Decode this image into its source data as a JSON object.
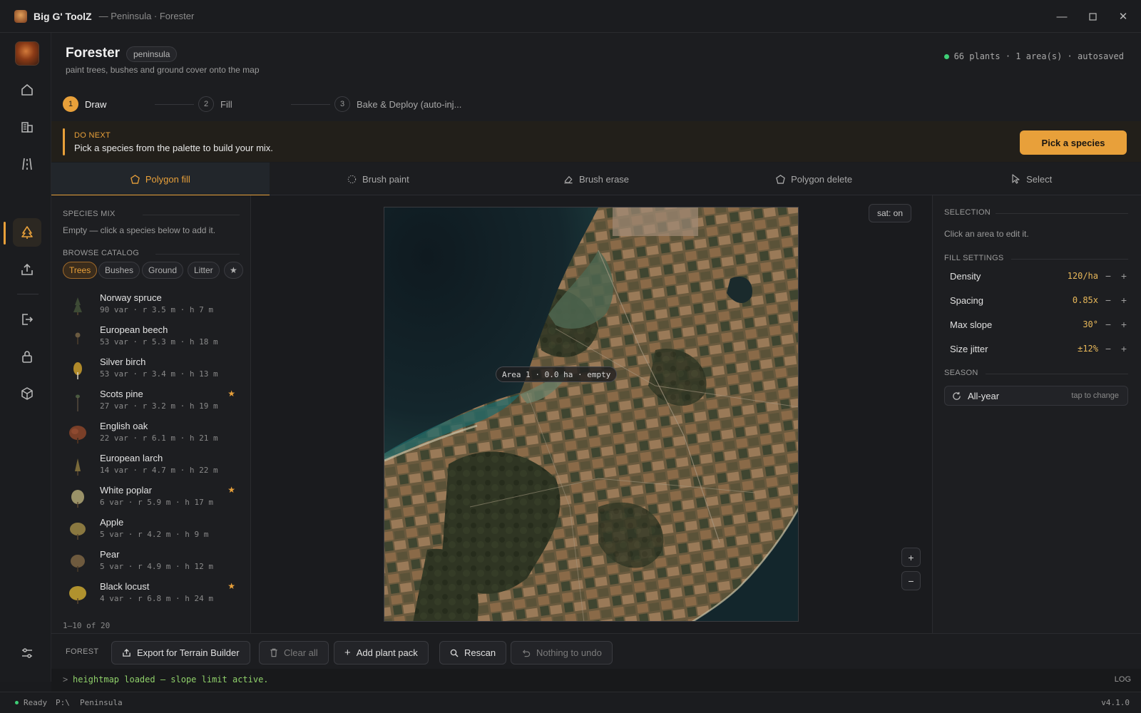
{
  "window": {
    "app_name": "Big G' ToolZ",
    "subtitle": "— Peninsula · Forester"
  },
  "rail": {
    "items": [
      {
        "name": "home",
        "icon": "home-icon"
      },
      {
        "name": "buildings",
        "icon": "buildings-icon"
      },
      {
        "name": "roads",
        "icon": "road-icon"
      },
      {
        "name": "forester",
        "icon": "tree-icon",
        "active": true
      },
      {
        "name": "export",
        "icon": "upload-tray-icon"
      },
      {
        "name": "deploy",
        "icon": "arrow-out-icon"
      },
      {
        "name": "lock",
        "icon": "lock-icon"
      },
      {
        "name": "assets",
        "icon": "cube-icon"
      },
      {
        "name": "settings",
        "icon": "sliders-icon"
      }
    ]
  },
  "header": {
    "title": "Forester",
    "badge": "peninsula",
    "subtitle": "paint trees, bushes and ground cover onto the map",
    "status": "66 plants · 1 area(s) · autosaved"
  },
  "stepper": {
    "steps": [
      {
        "num": "1",
        "label": "Draw"
      },
      {
        "num": "2",
        "label": "Fill"
      },
      {
        "num": "3",
        "label": "Bake & Deploy (auto-inj..."
      }
    ]
  },
  "banner": {
    "kicker": "DO NEXT",
    "text": "Pick a species from the palette to build your mix.",
    "button": "Pick a species"
  },
  "tools": {
    "tabs": [
      {
        "label": "Polygon fill",
        "icon": "polygon-icon"
      },
      {
        "label": "Brush paint",
        "icon": "brush-dots-icon"
      },
      {
        "label": "Brush erase",
        "icon": "eraser-icon"
      },
      {
        "label": "Polygon delete",
        "icon": "polygon-icon"
      },
      {
        "label": "Select",
        "icon": "cursor-icon"
      }
    ]
  },
  "species": {
    "mix_label": "SPECIES MIX",
    "mix_empty": "Empty — click a species below to add it.",
    "catalog_label": "BROWSE CATALOG",
    "filters": [
      "Trees",
      "Bushes",
      "Ground",
      "Litter",
      "★"
    ],
    "items": [
      {
        "name": "Norway spruce",
        "meta": "90 var · r 3.5 m · h 7 m",
        "star": ""
      },
      {
        "name": "European beech",
        "meta": "53 var · r 5.3 m · h 18 m",
        "star": ""
      },
      {
        "name": "Silver birch",
        "meta": "53 var · r 3.4 m · h 13 m",
        "star": ""
      },
      {
        "name": "Scots pine",
        "meta": "27 var · r 3.2 m · h 19 m",
        "star": "★"
      },
      {
        "name": "English oak",
        "meta": "22 var · r 6.1 m · h 21 m",
        "star": ""
      },
      {
        "name": "European larch",
        "meta": "14 var · r 4.7 m · h 22 m",
        "star": ""
      },
      {
        "name": "White poplar",
        "meta": "6 var · r 5.9 m · h 17 m",
        "star": "★"
      },
      {
        "name": "Apple",
        "meta": "5 var · r 4.2 m · h 9 m",
        "star": ""
      },
      {
        "name": "Pear",
        "meta": "5 var · r 4.9 m · h 12 m",
        "star": ""
      },
      {
        "name": "Black locust",
        "meta": "4 var · r 6.8 m · h 24 m",
        "star": "★"
      }
    ],
    "pager": "1–10 of 20"
  },
  "map": {
    "sat_toggle": "sat: on",
    "area_label": "Area 1 · 0.0 ha · empty",
    "zoom_in": "+",
    "zoom_out": "−"
  },
  "props": {
    "selection_label": "SELECTION",
    "selection_hint": "Click an area to edit it.",
    "fill_label": "FILL SETTINGS",
    "settings": [
      {
        "label": "Density",
        "value": "120/ha"
      },
      {
        "label": "Spacing",
        "value": "0.85x"
      },
      {
        "label": "Max slope",
        "value": "30°"
      },
      {
        "label": "Size jitter",
        "value": "±12%"
      }
    ],
    "season_label": "SEASON",
    "season_value": "All-year",
    "season_hint": "tap to change"
  },
  "actions": {
    "label": "FOREST",
    "buttons": [
      {
        "label": "Export for Terrain Builder",
        "icon": "export-icon"
      },
      {
        "label": "Clear all",
        "icon": "trash-icon"
      },
      {
        "label": "Add plant pack",
        "icon": "plus-icon"
      },
      {
        "label": "Rescan",
        "icon": "search-icon"
      },
      {
        "label": "Nothing to undo",
        "icon": "undo-icon"
      }
    ]
  },
  "log": {
    "prompt": ">",
    "line": "heightmap loaded — slope limit active.",
    "toggle": "LOG"
  },
  "statusbar": {
    "state": "Ready",
    "drive": "P:\\",
    "project": "Peninsula",
    "version": "v4.1.0"
  },
  "colors": {
    "accent": "#e8a03a",
    "status_ok": "#3ecf76",
    "log_text": "#8fd06a"
  }
}
